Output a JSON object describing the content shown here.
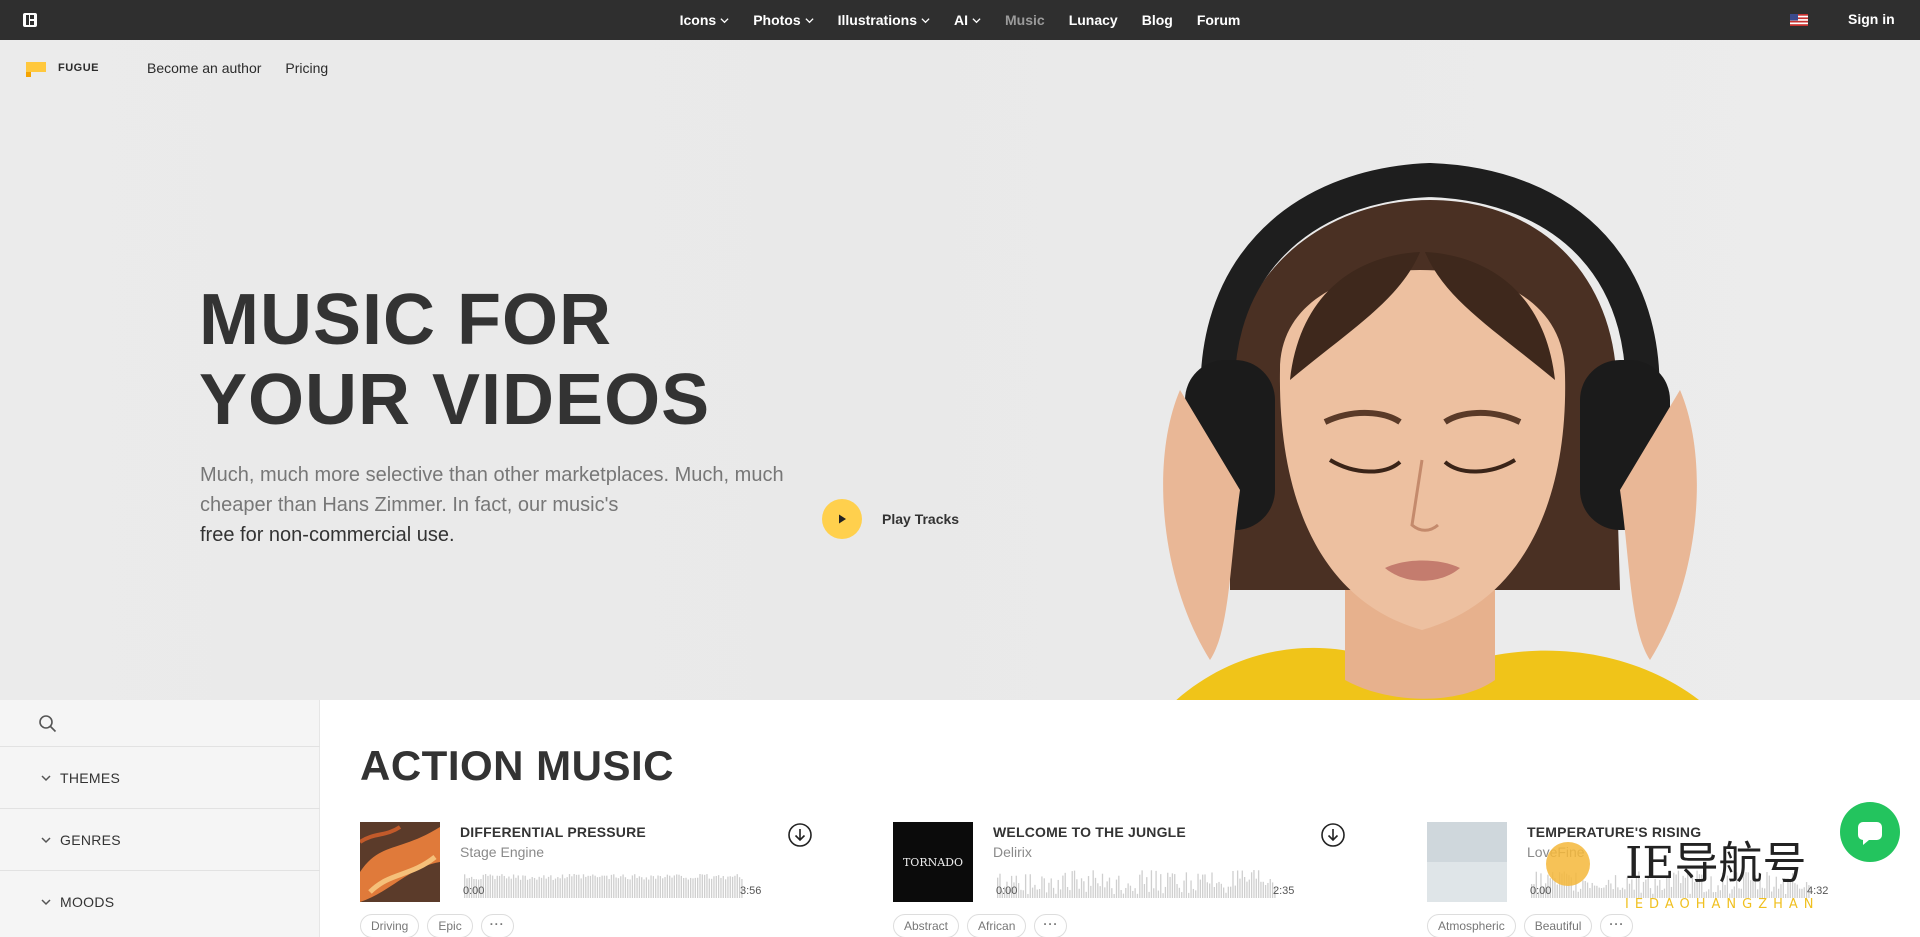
{
  "topbar": {
    "nav": [
      {
        "label": "Icons",
        "dropdown": true,
        "dim": false
      },
      {
        "label": "Photos",
        "dropdown": true,
        "dim": false
      },
      {
        "label": "Illustrations",
        "dropdown": true,
        "dim": false
      },
      {
        "label": "AI",
        "dropdown": true,
        "dim": false
      },
      {
        "label": "Music",
        "dropdown": false,
        "dim": true
      },
      {
        "label": "Lunacy",
        "dropdown": false,
        "dim": false
      },
      {
        "label": "Blog",
        "dropdown": false,
        "dim": false
      },
      {
        "label": "Forum",
        "dropdown": false,
        "dim": false
      }
    ],
    "signin": "Sign in"
  },
  "subnav": {
    "brand": "FUGUE",
    "links": [
      "Become an author",
      "Pricing"
    ]
  },
  "hero": {
    "title_line1": "MUSIC FOR",
    "title_line2": "YOUR VIDEOS",
    "subtitle": "Much, much more selective than other marketplaces. Much, much cheaper than Hans Zimmer. In fact, our music's",
    "subtitle_strong": "free for non-commercial use.",
    "play_label": "Play Tracks"
  },
  "sidebar": {
    "sections": [
      "THEMES",
      "GENRES",
      "MOODS"
    ]
  },
  "main": {
    "title": "ACTION MUSIC",
    "tracks": [
      {
        "title": "DIFFERENTIAL PRESSURE",
        "artist": "Stage Engine",
        "start": "0:00",
        "duration": "3:56",
        "tags": [
          "Driving",
          "Epic"
        ]
      },
      {
        "title": "WELCOME TO THE JUNGLE",
        "artist": "Delirix",
        "start": "0:00",
        "duration": "2:35",
        "tags": [
          "Abstract",
          "African"
        ],
        "cover_text": "TORNADO"
      },
      {
        "title": "TEMPERATURE'S RISING",
        "artist": "LoveFine",
        "start": "0:00",
        "duration": "4:32",
        "tags": [
          "Atmospheric",
          "Beautiful"
        ]
      }
    ],
    "more_tag": "···"
  },
  "watermark": {
    "text": "IE导航号",
    "sub": "IEDAOHANGZHAN"
  },
  "colors": {
    "accent": "#ffd04d",
    "topbar": "#2f2f2f",
    "chat": "#23c45e"
  }
}
